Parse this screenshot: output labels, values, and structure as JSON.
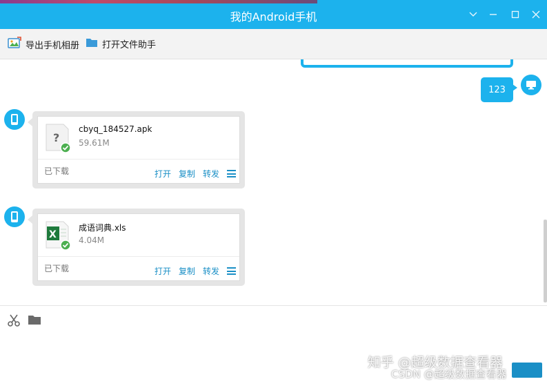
{
  "window": {
    "title": "我的Android手机",
    "accent_color": "#1cb2ed",
    "link_color": "#1a8fc6",
    "controls": [
      "chevron-down-icon",
      "minimize-icon",
      "maximize-icon",
      "close-icon"
    ]
  },
  "toolbar": {
    "export_album_label": "导出手机相册",
    "open_file_assistant_label": "打开文件助手"
  },
  "chat": {
    "my_message": "123",
    "files": [
      {
        "name": "cbyq_184527.apk",
        "size": "59.61M",
        "status": "已下载",
        "icon": "unknown-file-icon",
        "actions": {
          "open": "打开",
          "copy": "复制",
          "forward": "转发"
        }
      },
      {
        "name": "成语词典.xls",
        "size": "4.04M",
        "status": "已下载",
        "icon": "excel-file-icon",
        "actions": {
          "open": "打开",
          "copy": "复制",
          "forward": "转发"
        }
      }
    ]
  },
  "input": {
    "tools": [
      "scissors-icon",
      "folder-icon"
    ]
  },
  "watermarks": {
    "zhihu": "知乎 @超级数据查看器",
    "csdn": "CSDN @超级数据查看器"
  }
}
